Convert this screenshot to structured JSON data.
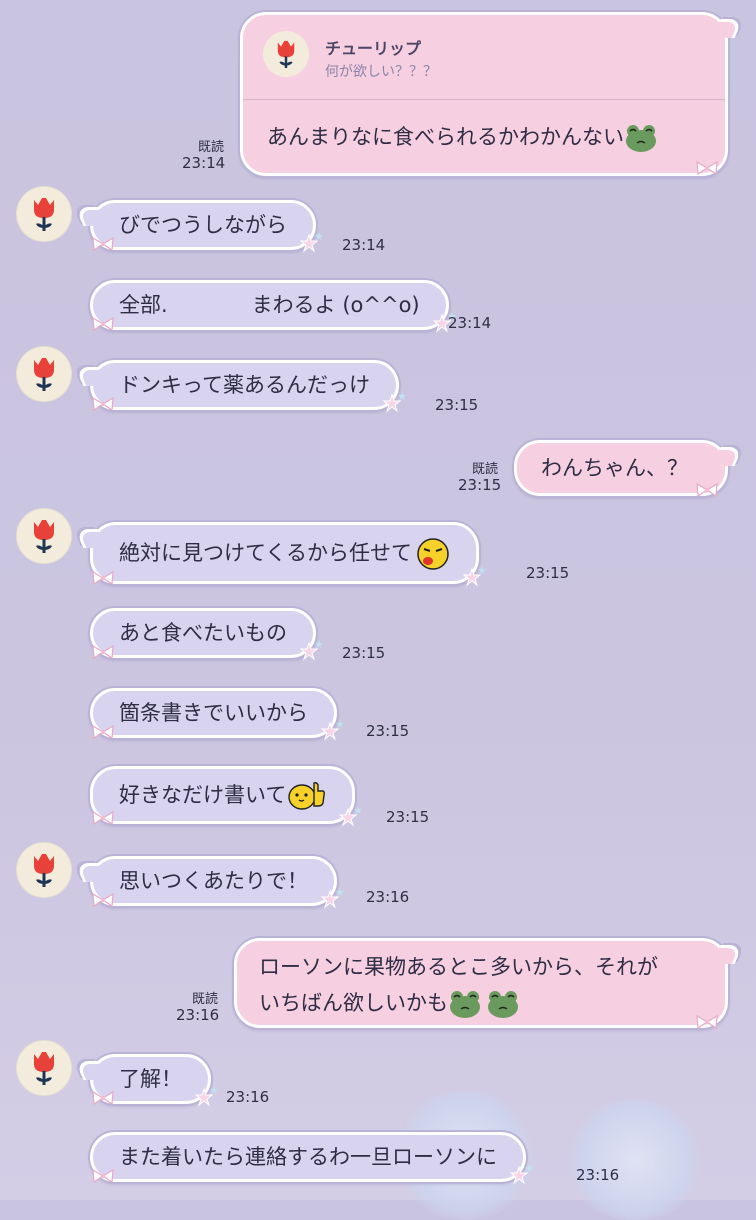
{
  "contact": {
    "name": "チューリップ"
  },
  "read_label": "既読",
  "messages": [
    {
      "dir": "out",
      "quote": {
        "name": "チューリップ",
        "text": "何が欲しい？？？"
      },
      "text": "あんまりなに食べられるかわかんない",
      "time": "23:14",
      "emoji": [
        "frog-emoji"
      ]
    },
    {
      "dir": "in",
      "text": "びでつうしながら",
      "time": "23:14"
    },
    {
      "dir": "in",
      "text": "全部.　　　　まわるよ (o^^o)",
      "time": "23:14"
    },
    {
      "dir": "in",
      "text": "ドンキって薬あるんだっけ",
      "time": "23:15"
    },
    {
      "dir": "out",
      "text": "わんちゃん、？",
      "time": "23:15"
    },
    {
      "dir": "in",
      "text": "絶対に見つけてくるから任せて",
      "time": "23:15",
      "emoji": [
        "wink-face-emoji"
      ]
    },
    {
      "dir": "in",
      "text": "あと食べたいもの",
      "time": "23:15"
    },
    {
      "dir": "in",
      "text": "箇条書きでいいから",
      "time": "23:15"
    },
    {
      "dir": "in",
      "text": "好きなだけ書いて",
      "time": "23:15",
      "emoji": [
        "thumbs-up-chick-emoji"
      ]
    },
    {
      "dir": "in",
      "text": "思いつくあたりで！",
      "time": "23:16"
    },
    {
      "dir": "out",
      "text_line1": "ローソンに果物あるとこ多いから、それが",
      "text_line2": "いちばん欲しいかも",
      "time": "23:16",
      "emoji": [
        "frog-emoji",
        "frog-emoji"
      ]
    },
    {
      "dir": "in",
      "text": "了解！",
      "time": "23:16"
    },
    {
      "dir": "in",
      "text": "また着いたら連絡するわ一旦ローソンに",
      "time": "23:16"
    }
  ],
  "colors": {
    "background": "#c9c4df",
    "incoming_bubble": "#d8d3ee",
    "outgoing_bubble": "#f6cfe0",
    "avatar_bg": "#f3ecdc",
    "tulip": "#e8413a"
  }
}
